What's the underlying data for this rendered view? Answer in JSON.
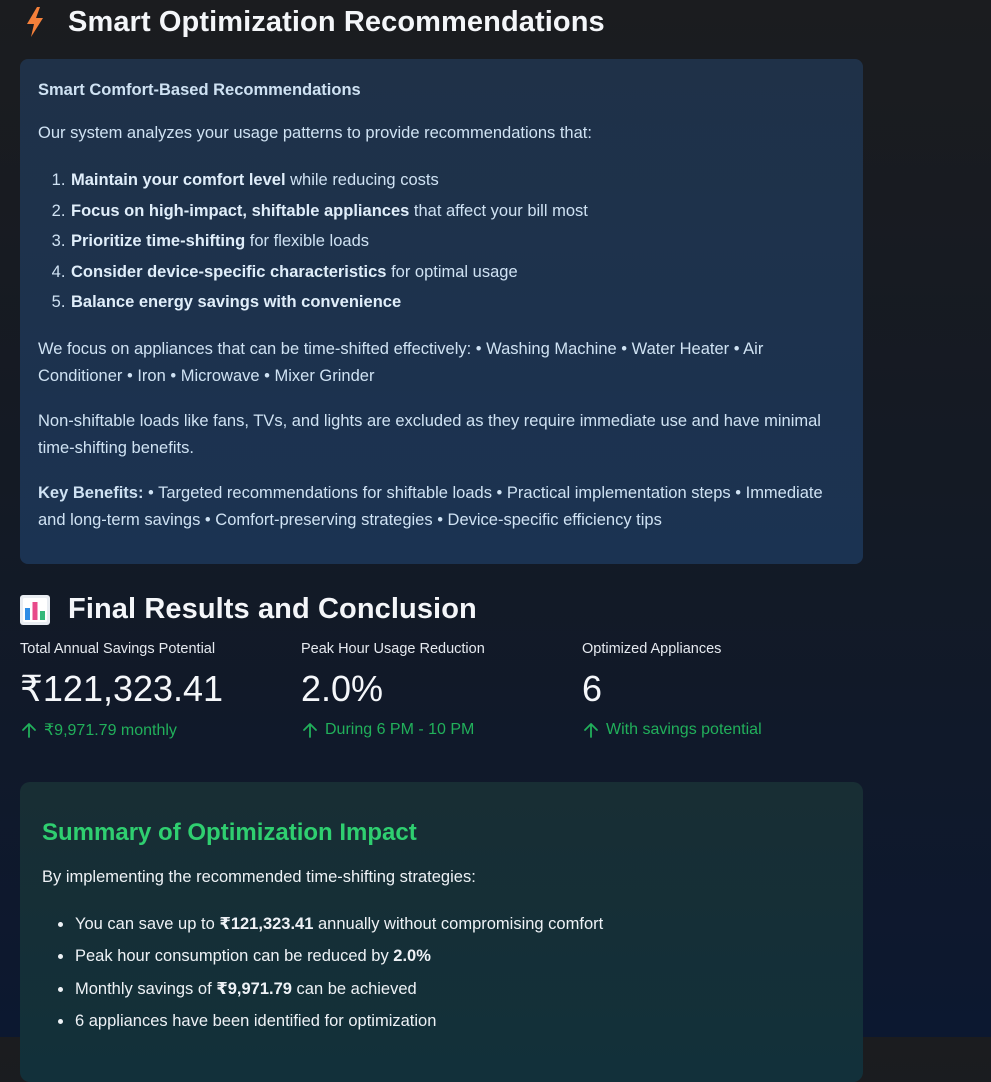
{
  "optimization": {
    "title": "Smart Optimization Recommendations",
    "icon": "lightning-icon",
    "box": {
      "title": "Smart Comfort-Based Recommendations",
      "intro": "Our system analyzes your usage patterns to provide recommendations that:",
      "points": [
        {
          "bold": "Maintain your comfort level",
          "rest": " while reducing costs"
        },
        {
          "bold": "Focus on high-impact, shiftable appliances",
          "rest": " that affect your bill most"
        },
        {
          "bold": "Prioritize time-shifting",
          "rest": " for flexible loads"
        },
        {
          "bold": "Consider device-specific characteristics",
          "rest": " for optimal usage"
        },
        {
          "bold": "Balance energy savings with convenience",
          "rest": ""
        }
      ],
      "shiftable_text": "We focus on appliances that can be time-shifted effectively: • Washing Machine • Water Heater • Air Conditioner • Iron • Microwave • Mixer Grinder",
      "non_shiftable_text": "Non-shiftable loads like fans, TVs, and lights are excluded as they require immediate use and have minimal time-shifting benefits.",
      "benefits_label": "Key Benefits:",
      "benefits_text": " • Targeted recommendations for shiftable loads • Practical implementation steps • Immediate and long-term savings • Comfort-preserving strategies • Device-specific efficiency tips"
    }
  },
  "results": {
    "title": "Final Results and Conclusion",
    "icon": "bar-chart-icon",
    "metrics": [
      {
        "label": "Total Annual Savings Potential",
        "value": "₹121,323.41",
        "delta": "₹9,971.79 monthly"
      },
      {
        "label": "Peak Hour Usage Reduction",
        "value": "2.0%",
        "delta": "During 6 PM - 10 PM"
      },
      {
        "label": "Optimized Appliances",
        "value": "6",
        "delta": "With savings potential"
      }
    ],
    "summary": {
      "title": "Summary of Optimization Impact",
      "intro": "By implementing the recommended time-shifting strategies:",
      "items": [
        {
          "pre": "You can save up to ",
          "bold": "₹121,323.41",
          "post": " annually without compromising comfort"
        },
        {
          "pre": "Peak hour consumption can be reduced by ",
          "bold": "2.0%",
          "post": ""
        },
        {
          "pre": "Monthly savings of ",
          "bold": "₹9,971.79",
          "post": " can be achieved"
        },
        {
          "pre": "",
          "bold": "",
          "post": "6 appliances have been identified for optimization"
        }
      ]
    }
  },
  "colors": {
    "accent_green": "#21b05b",
    "summary_title_green": "#2fcf70",
    "info_box_bg": "#1f3148",
    "lightning_orange": "#f5803a"
  }
}
